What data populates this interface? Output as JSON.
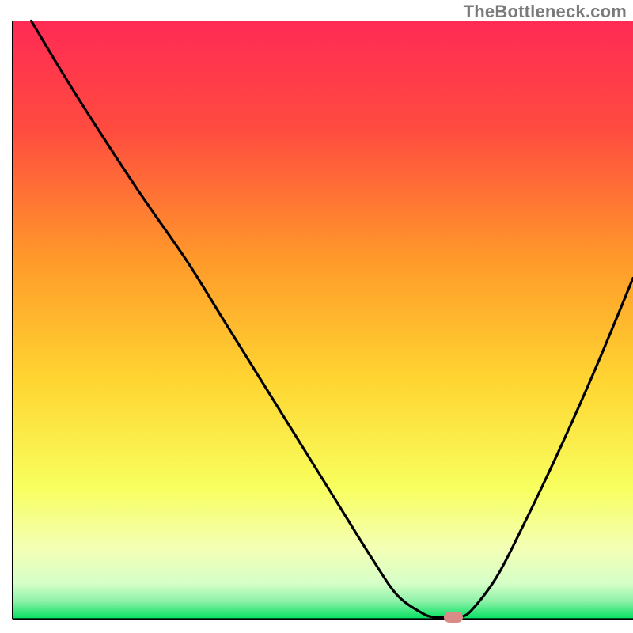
{
  "watermark": "TheBottleneck.com",
  "chart_data": {
    "type": "line",
    "title": "",
    "xlabel": "",
    "ylabel": "",
    "xlim": [
      0,
      100
    ],
    "ylim": [
      0,
      100
    ],
    "grid": false,
    "legend": false,
    "background_gradient": {
      "top": "#ff2a55",
      "mid_upper": "#ff6a33",
      "mid": "#ffd531",
      "mid_lower": "#f7ff66",
      "lower": "#e8ffb0",
      "bottom": "#00e060"
    },
    "series": [
      {
        "name": "curve",
        "color": "#000000",
        "x": [
          3,
          10,
          20,
          28,
          34,
          40,
          46,
          52,
          58,
          62,
          66,
          68,
          70,
          72,
          74,
          78,
          82,
          88,
          94,
          100
        ],
        "y": [
          100,
          88,
          72,
          60,
          50,
          40,
          30,
          20,
          10,
          4,
          1,
          0.3,
          0.3,
          0.3,
          1.5,
          7,
          15,
          28,
          42,
          57
        ]
      }
    ],
    "marker": {
      "x": 71,
      "y": 0.3,
      "color": "#d98b88"
    },
    "axes": {
      "left_x_frac": 0.02,
      "right_x_frac": 1.0,
      "top_y_frac": 0.033,
      "bottom_y_frac": 0.978
    }
  }
}
